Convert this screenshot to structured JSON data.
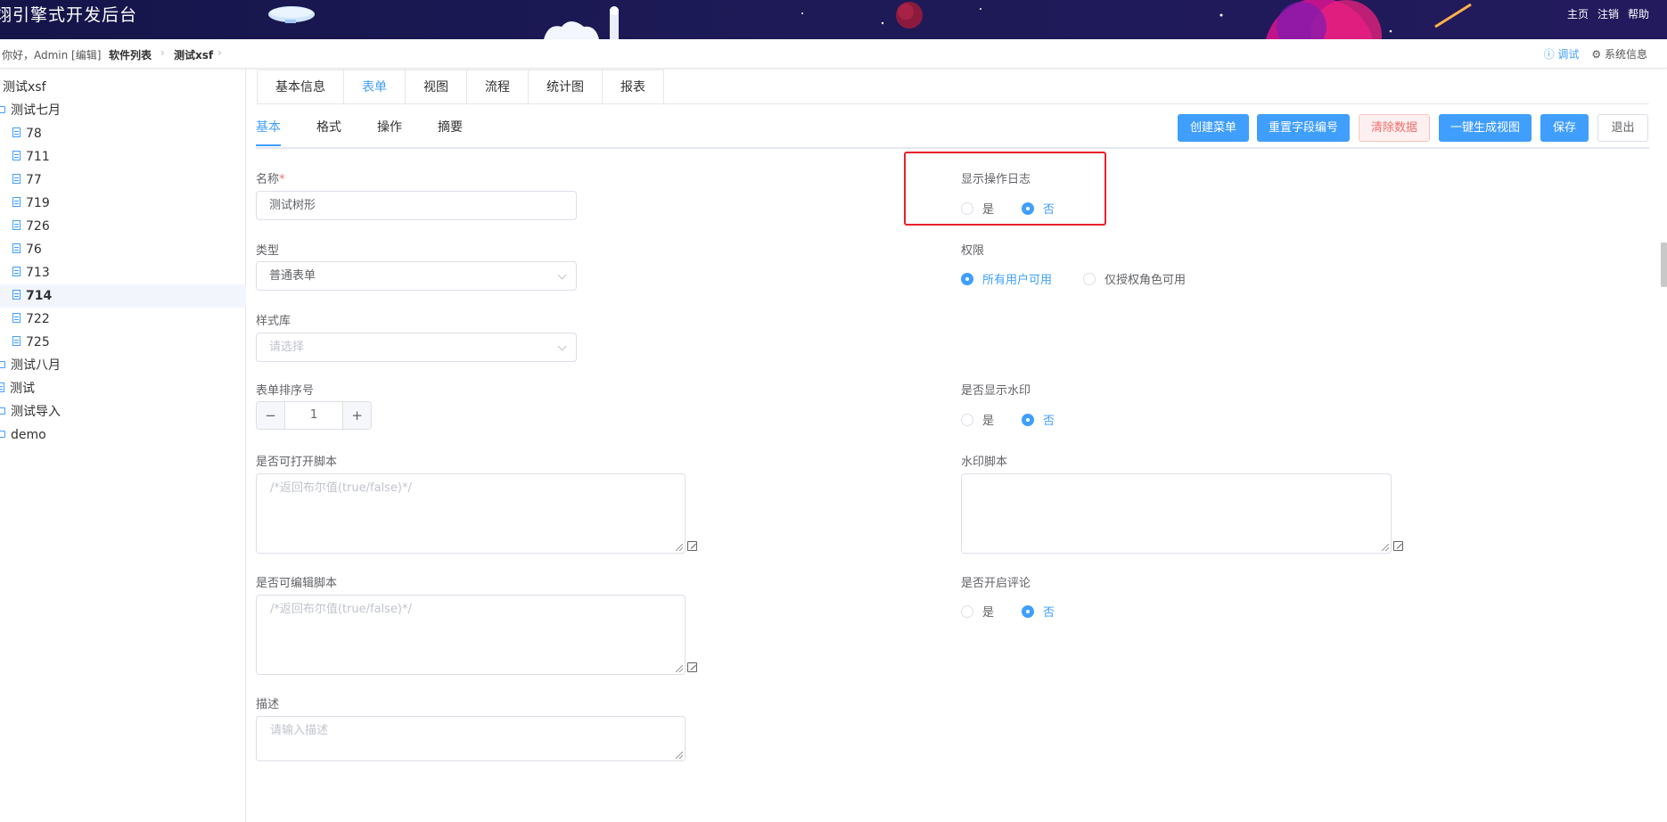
{
  "header": {
    "title": "翊引擎式开发后台",
    "links": {
      "home": "主页",
      "logout": "注销",
      "help": "帮助"
    }
  },
  "breadcrumb": {
    "greeting": "你好，Admin [编辑]",
    "items": [
      "软件列表",
      "测试xsf"
    ],
    "debug": "ⓘ 调试",
    "system": "⚙ 系统信息"
  },
  "sidebar": {
    "root": "测试xsf",
    "nodes": [
      {
        "label": "测试七月",
        "type": "folder"
      },
      {
        "label": "78",
        "type": "doc"
      },
      {
        "label": "711",
        "type": "doc"
      },
      {
        "label": "77",
        "type": "doc"
      },
      {
        "label": "719",
        "type": "doc"
      },
      {
        "label": "726",
        "type": "doc"
      },
      {
        "label": "76",
        "type": "doc"
      },
      {
        "label": "713",
        "type": "doc"
      },
      {
        "label": "714",
        "type": "doc",
        "selected": true
      },
      {
        "label": "722",
        "type": "doc"
      },
      {
        "label": "725",
        "type": "doc"
      },
      {
        "label": "测试八月",
        "type": "folder"
      },
      {
        "label": "测试",
        "type": "doc"
      },
      {
        "label": "测试导入",
        "type": "folder"
      },
      {
        "label": "demo",
        "type": "folder"
      }
    ]
  },
  "main_tabs": [
    "基本信息",
    "表单",
    "视图",
    "流程",
    "统计图",
    "报表"
  ],
  "sub_tabs": [
    "基本",
    "格式",
    "操作",
    "摘要"
  ],
  "actions": {
    "create_menu": "创建菜单",
    "reset_field": "重置字段编号",
    "clear_data": "清除数据",
    "gen_view": "一键生成视图",
    "save": "保存",
    "exit": "退出"
  },
  "form": {
    "name_label": "名称",
    "name_required": "*",
    "name_value": "测试树形",
    "type_label": "类型",
    "type_value": "普通表单",
    "style_label": "样式库",
    "style_placeholder": "请选择",
    "order_label": "表单排序号",
    "order_value": "1",
    "open_script_label": "是否可打开脚本",
    "open_script_placeholder": "/*返回布尔值(true/false)*/",
    "edit_script_label": "是否可编辑脚本",
    "edit_script_placeholder": "/*返回布尔值(true/false)*/",
    "desc_label": "描述",
    "desc_placeholder": "请输入描述",
    "log_label": "显示操作日志",
    "perm_label": "权限",
    "perm_all": "所有用户可用",
    "perm_role": "仅授权角色可用",
    "watermark_label": "是否显示水印",
    "watermark_script_label": "水印脚本",
    "comment_label": "是否开启评论",
    "yes": "是",
    "no": "否"
  }
}
